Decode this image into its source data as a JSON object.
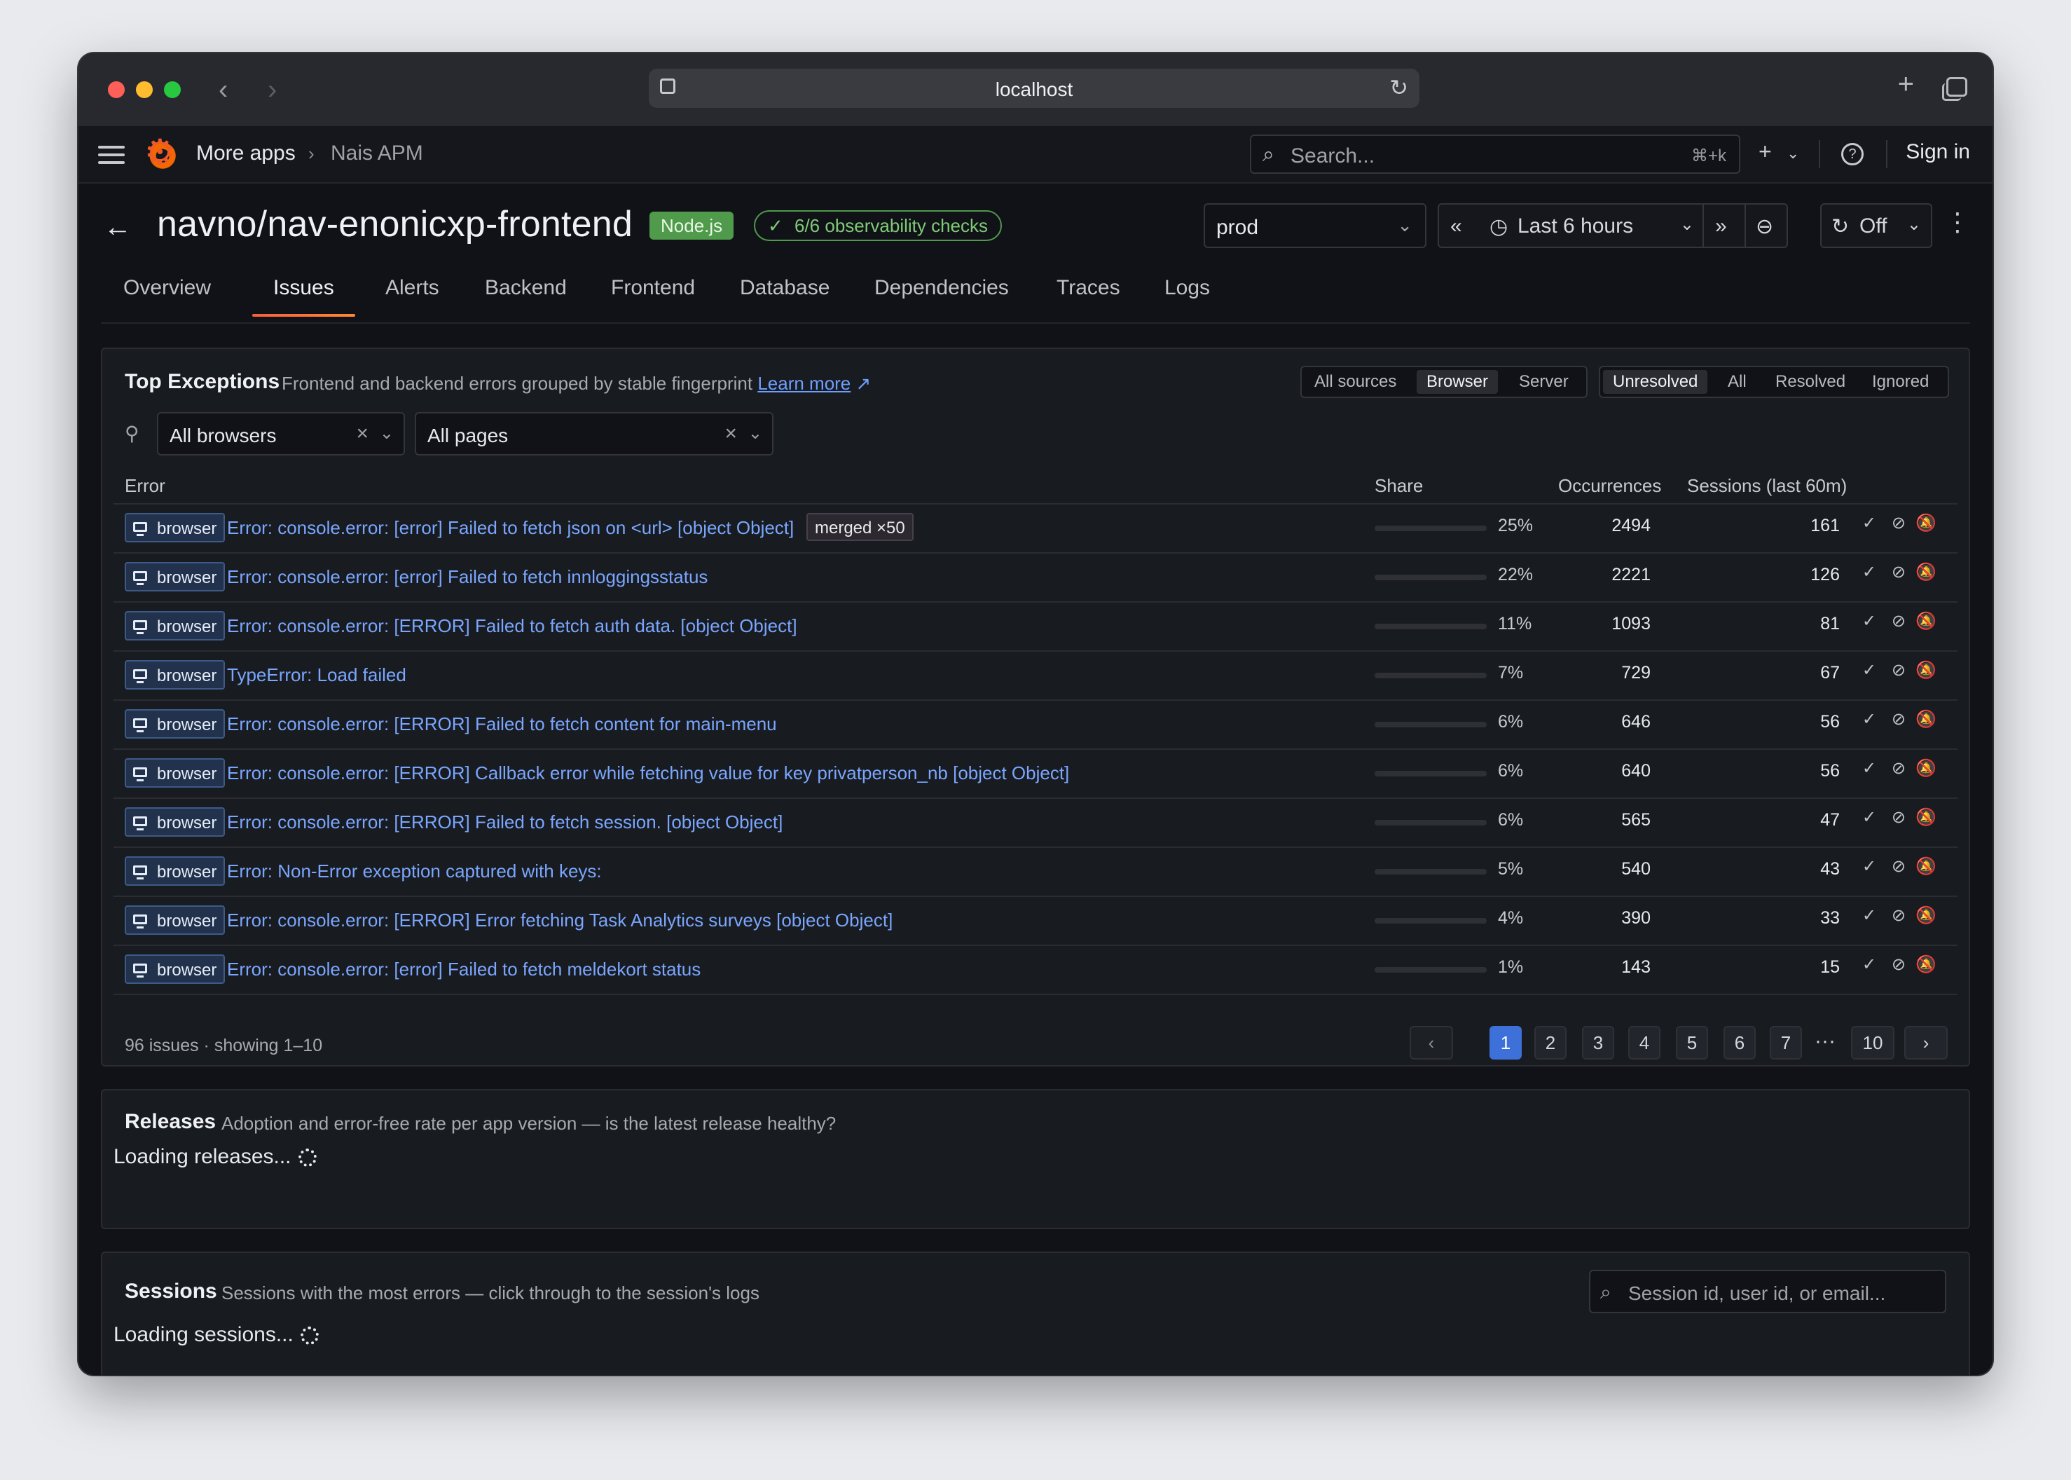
{
  "browser": {
    "url": "localhost"
  },
  "topbar": {
    "breadcrumb_root": "More apps",
    "breadcrumb_separator": "›",
    "breadcrumb_current": "Nais APM",
    "search_placeholder": "Search...",
    "search_shortcut": "⌘+k",
    "sign_in": "Sign in"
  },
  "header": {
    "title": "navno/nav-enonicxp-frontend",
    "runtime_badge": "Node.js",
    "checks_badge": "6/6 observability checks",
    "environment": "prod",
    "time_range": "Last 6 hours",
    "refresh": "Off"
  },
  "tabs": [
    {
      "label": "Overview",
      "active": false
    },
    {
      "label": "Issues",
      "active": true
    },
    {
      "label": "Alerts",
      "active": false
    },
    {
      "label": "Backend",
      "active": false
    },
    {
      "label": "Frontend",
      "active": false
    },
    {
      "label": "Database",
      "active": false
    },
    {
      "label": "Dependencies",
      "active": false
    },
    {
      "label": "Traces",
      "active": false
    },
    {
      "label": "Logs",
      "active": false
    }
  ],
  "exceptions": {
    "title": "Top Exceptions",
    "description": "Frontend and backend errors grouped by stable fingerprint",
    "learn_more": "Learn more",
    "source_filter": {
      "options": [
        "All sources",
        "Browser",
        "Server"
      ],
      "selected": "Browser"
    },
    "status_filter": {
      "options": [
        "Unresolved",
        "All",
        "Resolved",
        "Ignored"
      ],
      "selected": "Unresolved"
    },
    "browser_filter": "All browsers",
    "page_filter": "All pages",
    "columns": {
      "error": "Error",
      "share": "Share",
      "occurrences": "Occurrences",
      "sessions": "Sessions (last 60m)"
    },
    "rows": [
      {
        "source": "browser",
        "message": "Error: console.error: [error] Failed to fetch json on <url> [object Object]",
        "merged": "merged ×50",
        "share_pct": 25,
        "share": "25%",
        "occurrences": "2494",
        "sessions": "161"
      },
      {
        "source": "browser",
        "message": "Error: console.error: [error] Failed to fetch innloggingsstatus",
        "merged": "",
        "share_pct": 22,
        "share": "22%",
        "occurrences": "2221",
        "sessions": "126"
      },
      {
        "source": "browser",
        "message": "Error: console.error: [ERROR] Failed to fetch auth data. [object Object]",
        "merged": "",
        "share_pct": 11,
        "share": "11%",
        "occurrences": "1093",
        "sessions": "81"
      },
      {
        "source": "browser",
        "message": "TypeError: Load failed",
        "merged": "",
        "share_pct": 7,
        "share": "7%",
        "occurrences": "729",
        "sessions": "67"
      },
      {
        "source": "browser",
        "message": "Error: console.error: [ERROR] Failed to fetch content for main-menu",
        "merged": "",
        "share_pct": 6,
        "share": "6%",
        "occurrences": "646",
        "sessions": "56"
      },
      {
        "source": "browser",
        "message": "Error: console.error: [ERROR] Callback error while fetching value for key privatperson_nb [object Object]",
        "merged": "",
        "share_pct": 6,
        "share": "6%",
        "occurrences": "640",
        "sessions": "56"
      },
      {
        "source": "browser",
        "message": "Error: console.error: [ERROR] Failed to fetch session. [object Object]",
        "merged": "",
        "share_pct": 6,
        "share": "6%",
        "occurrences": "565",
        "sessions": "47"
      },
      {
        "source": "browser",
        "message": "Error: Non-Error exception captured with keys:",
        "merged": "",
        "share_pct": 5,
        "share": "5%",
        "occurrences": "540",
        "sessions": "43"
      },
      {
        "source": "browser",
        "message": "Error: console.error: [ERROR] Error fetching Task Analytics surveys [object Object]",
        "merged": "",
        "share_pct": 4,
        "share": "4%",
        "occurrences": "390",
        "sessions": "33"
      },
      {
        "source": "browser",
        "message": "Error: console.error: [error] Failed to fetch meldekort status",
        "merged": "",
        "share_pct": 1,
        "share": "1%",
        "occurrences": "143",
        "sessions": "15"
      }
    ],
    "footer": "96 issues · showing 1–10",
    "pagination": {
      "pages": [
        "1",
        "2",
        "3",
        "4",
        "5",
        "6",
        "7"
      ],
      "ellipsis": "···",
      "last": "10",
      "current": "1",
      "prev": "‹",
      "next": "›"
    }
  },
  "releases": {
    "title": "Releases",
    "description": "Adoption and error-free rate per app version — is the latest release healthy?",
    "loading": "Loading releases..."
  },
  "sessions": {
    "title": "Sessions",
    "description": "Sessions with the most errors — click through to the session's logs",
    "search_placeholder": "Session id, user id, or email...",
    "loading": "Loading sessions..."
  },
  "colors": {
    "accent_tab": "#f55f3e",
    "link": "#7aa6ff",
    "share_bar": "#c4316a",
    "node_badge": "#4f9a4b",
    "pager_active": "#3d71d9"
  }
}
